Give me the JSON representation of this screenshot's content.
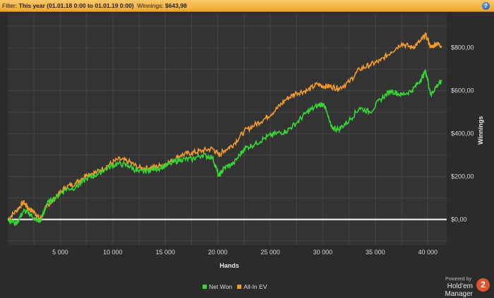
{
  "filter": {
    "label": "Filter: ",
    "value": "This year (01.01.18 0:00 to 01.01.19 0:00)",
    "winnings_label": "  Winnings: ",
    "winnings_value": "$643,98"
  },
  "help_icon": "question-icon",
  "branding": {
    "powered": "Powered by",
    "product": "Hold'em Manager",
    "badge": "2"
  },
  "colors": {
    "net_won": "#36d633",
    "all_in_ev": "#f39a2e",
    "zero_line": "#ffffff",
    "background": "#2b2b2b"
  },
  "chart_data": {
    "type": "line",
    "xlabel": "Hands",
    "ylabel": "Winnings",
    "xlim": [
      0,
      41800
    ],
    "ylim": [
      -120,
      960
    ],
    "xticks": [
      5000,
      10000,
      15000,
      20000,
      25000,
      30000,
      35000,
      40000
    ],
    "xtick_labels": [
      "5 000",
      "10 000",
      "15 000",
      "20 000",
      "25 000",
      "30 000",
      "35 000",
      "40 000"
    ],
    "yticks": [
      0,
      200,
      400,
      600,
      800
    ],
    "ytick_labels": [
      "$0,00",
      "$200,00",
      "$400,00",
      "$600,00",
      "$800,00"
    ],
    "grid": true,
    "legend_position": "bottom-center",
    "series": [
      {
        "name": "Net Won",
        "x": [
          0,
          800,
          1500,
          2000,
          2600,
          3100,
          3700,
          4500,
          5500,
          6500,
          7500,
          8500,
          9500,
          10500,
          11500,
          12500,
          13500,
          14500,
          15500,
          16500,
          17500,
          18500,
          19500,
          20100,
          20600,
          21500,
          22500,
          23500,
          24500,
          25500,
          26500,
          27500,
          28500,
          29500,
          30100,
          30800,
          31500,
          32500,
          33500,
          34500,
          35500,
          36500,
          37500,
          38500,
          39300,
          39800,
          40300,
          40800,
          41300
        ],
        "y": [
          0,
          -20,
          40,
          30,
          0,
          -10,
          70,
          100,
          140,
          150,
          190,
          210,
          240,
          260,
          250,
          220,
          230,
          240,
          260,
          280,
          280,
          300,
          290,
          200,
          240,
          260,
          330,
          350,
          380,
          400,
          410,
          450,
          500,
          530,
          540,
          430,
          420,
          460,
          520,
          500,
          560,
          600,
          580,
          600,
          650,
          690,
          580,
          620,
          640
        ]
      },
      {
        "name": "All-In EV",
        "x": [
          0,
          800,
          1500,
          2000,
          2600,
          3100,
          3700,
          4500,
          5500,
          6500,
          7500,
          8500,
          9500,
          10500,
          11500,
          12500,
          13500,
          14500,
          15500,
          16500,
          17500,
          18500,
          19500,
          20100,
          20600,
          21500,
          22500,
          23500,
          24500,
          25500,
          26500,
          27500,
          28500,
          29500,
          30100,
          30800,
          31500,
          32500,
          33500,
          34500,
          35500,
          36500,
          37500,
          38500,
          39300,
          39800,
          40300,
          40800,
          41300
        ],
        "y": [
          0,
          40,
          80,
          50,
          30,
          0,
          60,
          100,
          150,
          170,
          210,
          220,
          250,
          280,
          270,
          240,
          240,
          250,
          270,
          300,
          310,
          320,
          330,
          300,
          320,
          350,
          410,
          440,
          470,
          510,
          560,
          590,
          600,
          630,
          620,
          620,
          610,
          640,
          700,
          720,
          740,
          780,
          820,
          800,
          830,
          860,
          800,
          820,
          810
        ]
      }
    ]
  }
}
